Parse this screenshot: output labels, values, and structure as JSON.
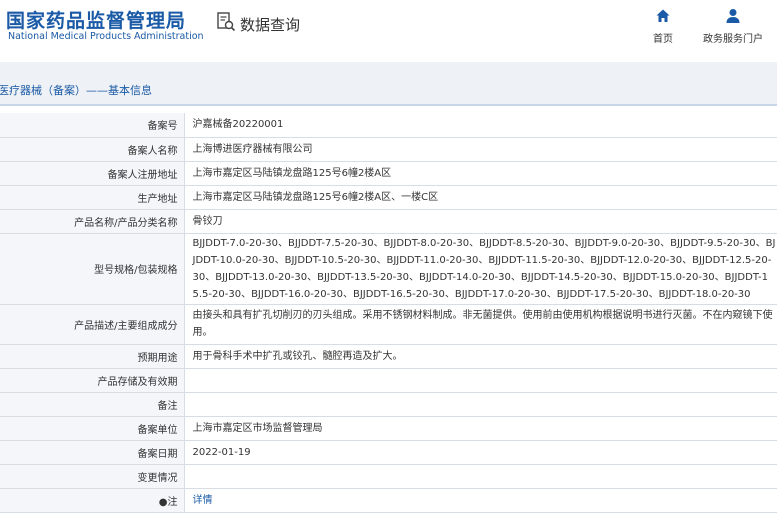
{
  "header": {
    "org_name_cn": "国家药品监督管理局",
    "org_name_en": "National Medical Products Administration",
    "query_label": "数据查询",
    "nav": [
      {
        "label": "首页",
        "icon": "home-icon"
      },
      {
        "label": "政务服务门户",
        "icon": "user-icon"
      }
    ]
  },
  "breadcrumb": "医疗器械（备案）——基本信息",
  "accent_color": "#1a5aa6",
  "rows": [
    {
      "label": "备案号",
      "value": "沪嘉械备20220001"
    },
    {
      "label": "备案人名称",
      "value": "上海博进医疗器械有限公司"
    },
    {
      "label": "备案人注册地址",
      "value": "上海市嘉定区马陆镇龙盘路125号6幢2楼A区"
    },
    {
      "label": "生产地址",
      "value": "上海市嘉定区马陆镇龙盘路125号6幢2楼A区、一楼C区"
    },
    {
      "label": "产品名称/产品分类名称",
      "value": "骨铰刀"
    },
    {
      "label": "型号规格/包装规格",
      "value": "BJJDDT-7.0-20-30、BJJDDT-7.5-20-30、BJJDDT-8.0-20-30、BJJDDT-8.5-20-30、BJJDDT-9.0-20-30、BJJDDT-9.5-20-30、BJJDDT-10.0-20-30、BJJDDT-10.5-20-30、BJJDDT-11.0-20-30、BJJDDT-11.5-20-30、BJJDDT-12.0-20-30、BJJDDT-12.5-20-30、BJJDDT-13.0-20-30、BJJDDT-13.5-20-30、BJJDDT-14.0-20-30、BJJDDT-14.5-20-30、BJJDDT-15.0-20-30、BJJDDT-15.5-20-30、BJJDDT-16.0-20-30、BJJDDT-16.5-20-30、BJJDDT-17.0-20-30、BJJDDT-17.5-20-30、BJJDDT-18.0-20-30"
    },
    {
      "label": "产品描述/主要组成成分",
      "value": "由接头和具有扩孔切削刃的刃头组成。采用不锈钢材料制成。非无菌提供。使用前由使用机构根据说明书进行灭菌。不在内窥镜下使用。"
    },
    {
      "label": "预期用途",
      "value": "用于骨科手术中扩孔或铰孔、髓腔再造及扩大。"
    },
    {
      "label": "产品存储及有效期",
      "value": ""
    },
    {
      "label": "备注",
      "value": ""
    },
    {
      "label": "备案单位",
      "value": "上海市嘉定区市场监督管理局"
    },
    {
      "label": "备案日期",
      "value": "2022-01-19"
    },
    {
      "label": "变更情况",
      "value": ""
    },
    {
      "label": "注",
      "value": "详情",
      "label_icon": "bullet-icon"
    }
  ]
}
